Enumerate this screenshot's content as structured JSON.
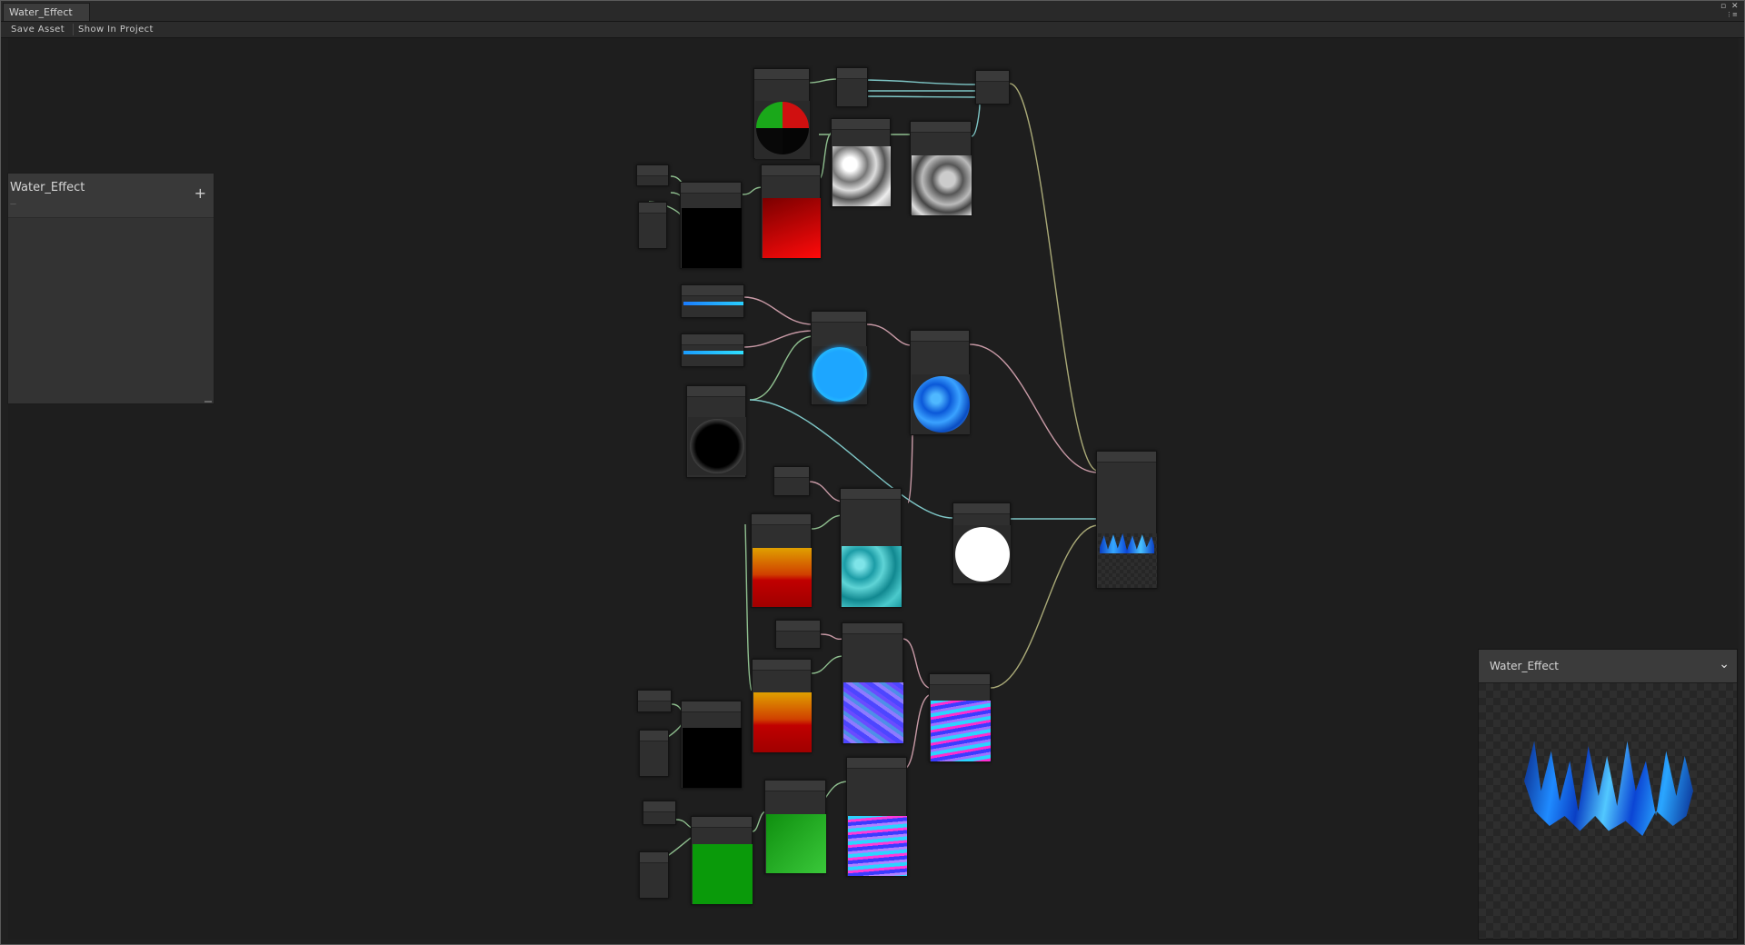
{
  "window": {
    "tab_title": "Water_Effect",
    "controls": [
      "▫",
      "✕",
      "⋮≡"
    ]
  },
  "toolbar": {
    "save_asset": "Save Asset",
    "show_in_project": "Show In Project"
  },
  "blackboard": {
    "title": "Water_Effect",
    "subtitle": "—",
    "add_icon": "+"
  },
  "main_preview": {
    "title": "Water_Effect",
    "chevron": "⌄"
  },
  "colors": {
    "canvas": "#1e1e1e",
    "node_body": "#2f2f2f",
    "wire_green": "#8fbf8f",
    "wire_teal": "#7ec6c6",
    "wire_pink": "#c89aa6",
    "wire_olive": "#a9a977",
    "water_blue": "#29b6ff",
    "preview_red": "#d00000",
    "preview_green": "#17a317"
  }
}
